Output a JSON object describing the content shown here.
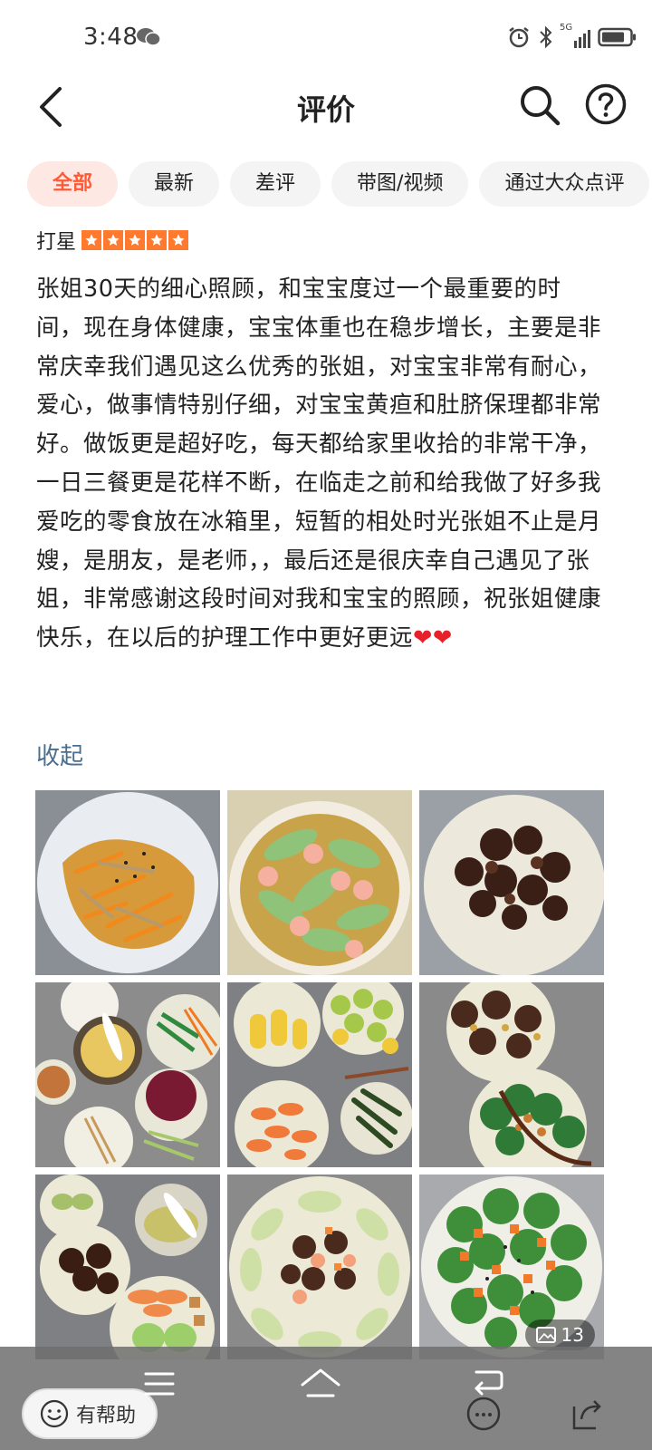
{
  "status_bar": {
    "time": "3:48",
    "network": "5G",
    "icons": [
      "wechat-icon",
      "alarm-icon",
      "bluetooth-icon",
      "signal-icon",
      "battery-icon"
    ]
  },
  "header": {
    "title": "评价",
    "icons": [
      "back-arrow-icon",
      "search-icon",
      "help-icon"
    ]
  },
  "tabs": [
    "全部",
    "最新",
    "差评",
    "带图/视频",
    "通过大众点评"
  ],
  "active_tab": "全部",
  "review": {
    "rating_label": "打星",
    "stars": 5,
    "text": "张姐30天的细心照顾，和宝宝度过一个最重要的时间，现在身体健康，宝宝体重也在稳步增长，主要是非常庆幸我们遇见这么优秀的张姐，对宝宝非常有耐心，爱心，做事情特别仔细，对宝宝黄疸和肚脐保理都非常好。做饭更是超好吃，每天都给家里收拾的非常干净，一日三餐更是花样不断，在临走之前和给我做了好多我爱吃的零食放在冰箱里，短暂的相处时光张姐不止是月嫂，是朋友，是老师，，最后还是很庆幸自己遇见了张姐，非常感谢这段时间对我和宝宝的照顾，祝张姐健康快乐，在以后的护理工作中更好更远",
    "emoji": "❤❤",
    "collapse_label": "收起",
    "photo_count": "13"
  },
  "actions": {
    "helpful_label": "有帮助"
  },
  "colors": {
    "accent": "#ff5a36",
    "star": "#ff7a2e",
    "link": "#4a6f8e",
    "heart": "#e8202a"
  }
}
